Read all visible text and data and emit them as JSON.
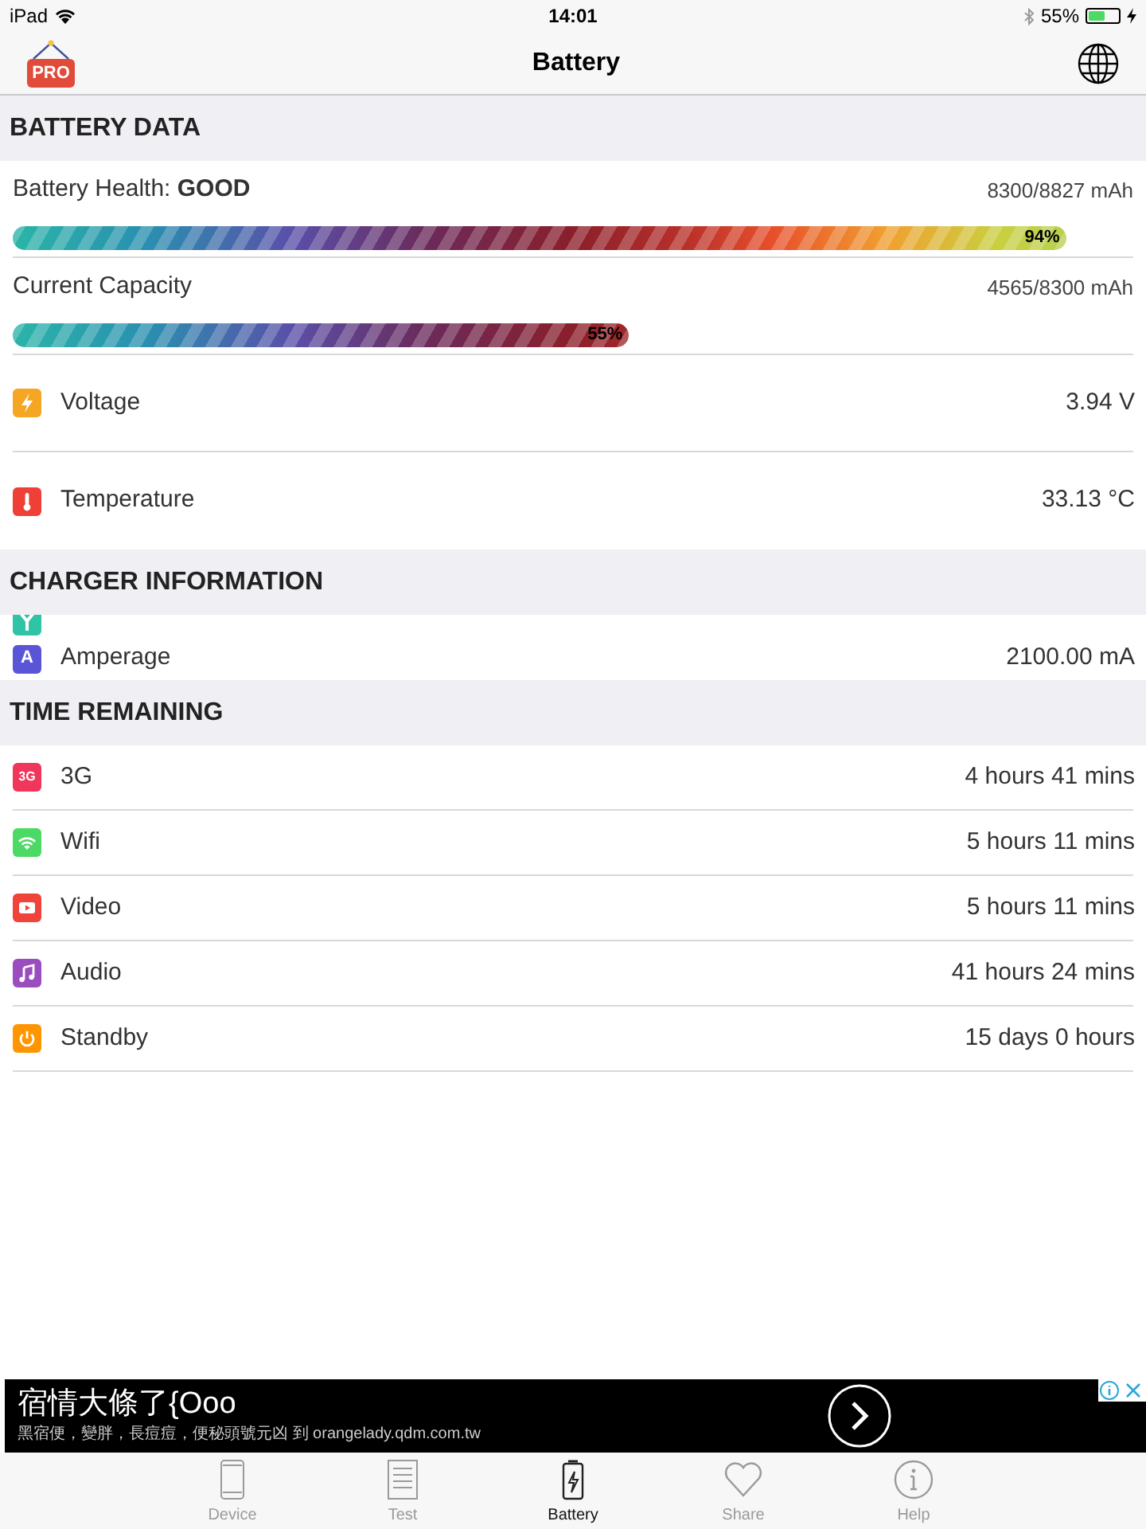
{
  "status_bar": {
    "device": "iPad",
    "time": "14:01",
    "battery_percent": "55%",
    "charging": true
  },
  "nav": {
    "title": "Battery",
    "badge": "PRO"
  },
  "sections": [
    {
      "title": "BATTERY DATA",
      "rows": [
        {
          "kind": "bar",
          "label": "Battery Health: **GOOD**",
          "value": "8300/8827 mAh",
          "level": 0.94,
          "percent": "94%"
        },
        {
          "kind": "bar",
          "label": "Current Capacity",
          "value": "4565/8300 mAh",
          "level": 0.55,
          "percent": "55%"
        },
        {
          "kind": "item",
          "color": "#f5a623",
          "label": "Voltage",
          "value": "3.94 V"
        },
        {
          "kind": "item",
          "color": "#ee4036",
          "label": "Temperature",
          "value": "33.13 °C"
        }
      ]
    },
    {
      "title": "CHARGER INFORMATION",
      "rows": [
        {
          "kind": "partial",
          "color": "#2ec4a5"
        },
        {
          "kind": "item",
          "glyph": "A",
          "color": "#5a55d6",
          "label": "Amperage",
          "value": "2100.00 mA"
        }
      ]
    },
    {
      "title": "TIME REMAINING",
      "rows": [
        {
          "kind": "item",
          "glyph": "3G",
          "color": "#f0365a",
          "label": "3G",
          "value": "4 hours 41 mins"
        },
        {
          "kind": "item",
          "color": "#4cd964",
          "label": "Wifi",
          "value": "5 hours 11 mins"
        },
        {
          "kind": "item",
          "color": "#f0433a",
          "label": "Video",
          "value": "5 hours 11 mins"
        },
        {
          "kind": "item",
          "color": "#9b4dbf",
          "label": "Audio",
          "value": "41 hours 24 mins"
        },
        {
          "kind": "item",
          "color": "#ff9500",
          "label": "Standby",
          "value": "15 days 0 hours"
        }
      ]
    }
  ],
  "ad": {
    "headline": "宿情大條了{Ooo",
    "body": "黑宿便，變胖，長痘痘，便秘頭號元凶 到 orangelady.qdm.com.tw"
  },
  "tabs": [
    {
      "label": "Device",
      "selected": false
    },
    {
      "label": "Test",
      "selected": false
    },
    {
      "label": "Battery",
      "selected": true
    },
    {
      "label": "Share",
      "selected": false
    },
    {
      "label": "Help",
      "selected": false
    }
  ]
}
